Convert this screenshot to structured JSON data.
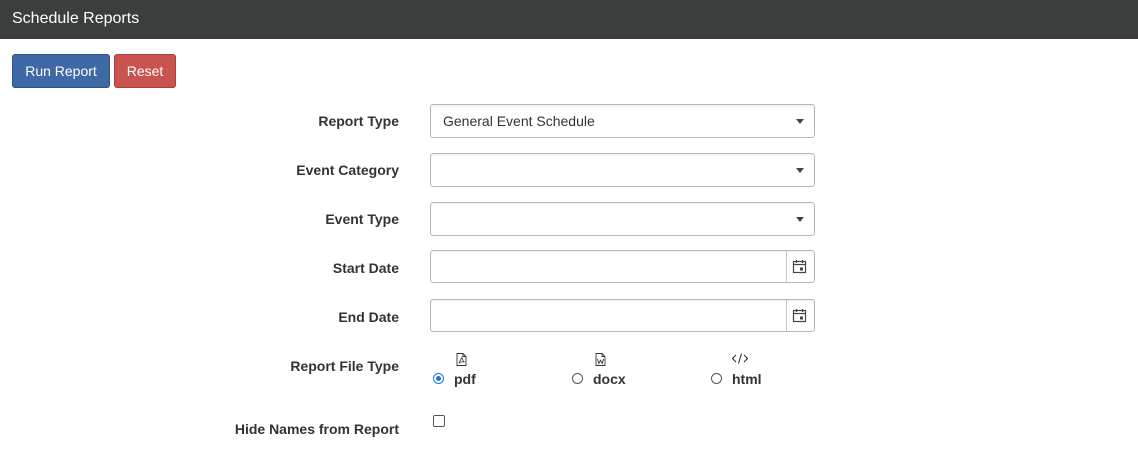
{
  "header": {
    "title": "Schedule Reports"
  },
  "toolbar": {
    "run_label": "Run Report",
    "reset_label": "Reset"
  },
  "form": {
    "report_type": {
      "label": "Report Type",
      "value": "General Event Schedule"
    },
    "event_category": {
      "label": "Event Category",
      "value": ""
    },
    "event_type": {
      "label": "Event Type",
      "value": ""
    },
    "start_date": {
      "label": "Start Date",
      "value": ""
    },
    "end_date": {
      "label": "End Date",
      "value": ""
    },
    "report_file_type": {
      "label": "Report File Type",
      "selected": "pdf",
      "options": [
        {
          "label": "pdf",
          "icon": "pdf-file-icon"
        },
        {
          "label": "docx",
          "icon": "word-file-icon"
        },
        {
          "label": "html",
          "icon": "code-icon"
        }
      ]
    },
    "hide_names": {
      "label": "Hide Names from Report",
      "checked": false
    }
  }
}
